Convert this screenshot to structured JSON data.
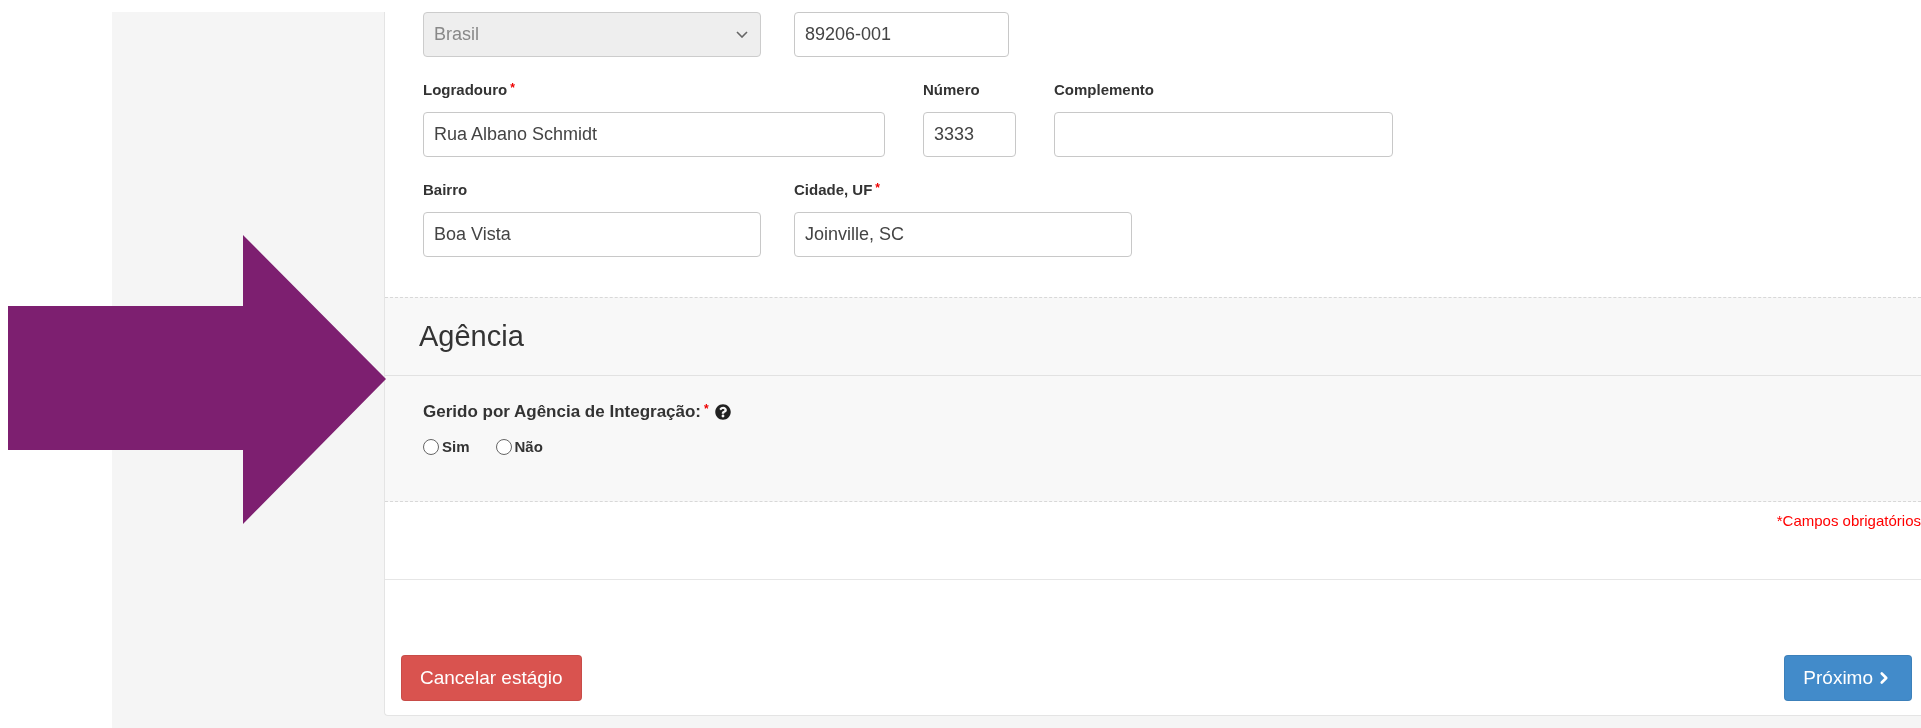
{
  "required_mark": "*",
  "address_rows": [
    [
      {
        "kind": "select",
        "value": "Brasil",
        "disabled": true
      },
      {
        "kind": "input",
        "value": "89206-001"
      }
    ],
    [
      {
        "kind": "input",
        "label": "Logradouro",
        "required": true,
        "value": "Rua Albano Schmidt"
      },
      {
        "kind": "input",
        "label": "Número",
        "required": false,
        "value": "3333"
      },
      {
        "kind": "input",
        "label": "Complemento",
        "required": false
      }
    ],
    [
      {
        "kind": "input",
        "label": "Bairro",
        "required": false,
        "value": "Boa Vista"
      },
      {
        "kind": "input",
        "label": "Cidade, UF",
        "required": true,
        "value": "Joinville, SC"
      }
    ]
  ],
  "agency_section": {
    "title": "Agência",
    "question": "Gerido por Agência de Integração:",
    "required": true,
    "options": [
      {
        "label": "Sim",
        "selected": false
      },
      {
        "label": "Não",
        "selected": false
      }
    ]
  },
  "required_note": "*Campos obrigatórios",
  "buttons": {
    "cancel": "Cancelar estágio",
    "next": "Próximo"
  }
}
